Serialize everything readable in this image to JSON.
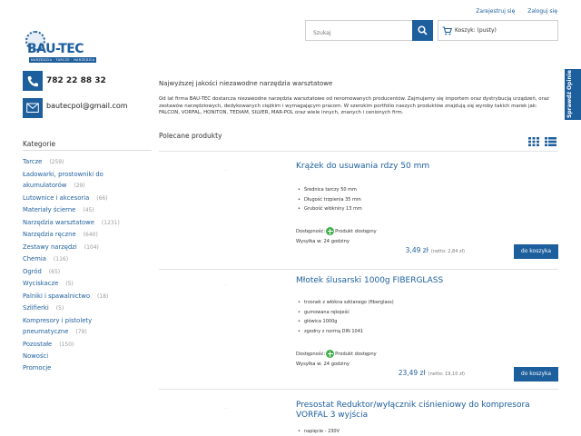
{
  "header": {
    "register": "Zarejestruj się",
    "login": "Zaloguj się",
    "search_placeholder": "Szukaj",
    "cart": "Koszyk: (pusty)",
    "logo_name": "BAU-TEC",
    "logo_tag": "NARZĘDZIA · TARCZE · NARZĘDZIA",
    "side_tab": "Sprawdź Opinie"
  },
  "contact": {
    "phone": "782 22 88 32",
    "email": "bautecpol@gmail.com"
  },
  "sidebar": {
    "title": "Kategorie",
    "items": [
      {
        "label": "Tarcze",
        "count": "(259)"
      },
      {
        "label": "Ładowarki, prostowniki do akumulatorów",
        "count": "(29)"
      },
      {
        "label": "Lutownice i akcesoria",
        "count": "(66)"
      },
      {
        "label": "Materiały ścierne",
        "count": "(45)"
      },
      {
        "label": "Narzędzia warsztatowe",
        "count": "(1231)"
      },
      {
        "label": "Narzędzia ręczne",
        "count": "(640)"
      },
      {
        "label": "Zestawy narzędzi",
        "count": "(104)"
      },
      {
        "label": "Chemia",
        "count": "(116)"
      },
      {
        "label": "Ogród",
        "count": "(65)"
      },
      {
        "label": "Wyciskacze",
        "count": "(5)"
      },
      {
        "label": "Palniki i spawalnictwo",
        "count": "(18)"
      },
      {
        "label": "Szlifierki",
        "count": "(5)"
      },
      {
        "label": "Kompresory i pistolety pneumatyczne",
        "count": "(79)"
      },
      {
        "label": "Pozostałe",
        "count": "(150)"
      },
      {
        "label": "Nowości",
        "count": ""
      },
      {
        "label": "Promocje",
        "count": ""
      }
    ]
  },
  "main": {
    "title": "Najwyższej jakości niezawodne narzędzia warsztatowe",
    "description": "Od lat firma BAU-TEC dostarcza niezawodne narzędzia warsztatowe od renomowanych producentów. Zajmujemy się importem oraz dystrybucją urządzeń, oraz zestawów narzędziowych, dedykowanych ciężkim i wymagającym pracom. W szerokim portfolio naszych produktów znajdują się wyroby takich marek jak: FALCON, VORFAL, HONITON, TEDIAM, SILVER, MAR-POL oraz wiele innych, znanych i cenionych firm.",
    "featured": "Polecane produkty"
  },
  "products": [
    {
      "name": "Krążek do usuwania rdzy 50 mm",
      "features": [
        "Średnica tarczy 50 mm",
        "Długość trzpienia 35 mm",
        "Grubość włókniny 13 mm"
      ],
      "availability_label": "Dostępność:",
      "availability": "Produkt dostępny",
      "shipping": "Wysyłka w: 24 godziny",
      "price": "3,49 zł",
      "net": "(netto: 2,84 zł)",
      "buy": "do koszyka"
    },
    {
      "name": "Młotek ślusarski 1000g FIBERGLASS",
      "features": [
        "trzonek z włókna szklanego (fiberglass)",
        "gumowana rękojeść",
        "główica 1000g",
        "zgodny z normą DIN 1041"
      ],
      "availability_label": "Dostępność:",
      "availability": "Produkt dostępny",
      "shipping": "Wysyłka w: 24 godziny",
      "price": "23,49 zł",
      "net": "(netto: 19,10 zł)",
      "buy": "do koszyka"
    },
    {
      "name": "Presostat Reduktor/wyłącznik ciśnieniowy do kompresora VORFAL 3 wyjścia",
      "features": [
        "napięcie - 230V"
      ]
    }
  ],
  "colors": {
    "accent": "#1d5e9c",
    "available": "#3fae49"
  }
}
